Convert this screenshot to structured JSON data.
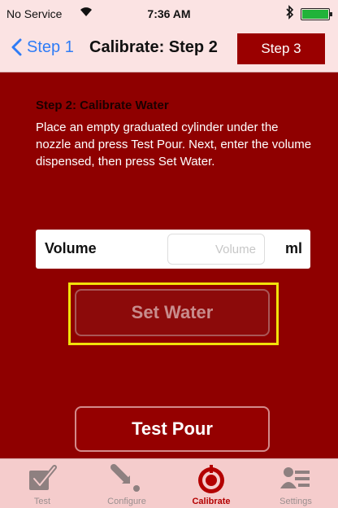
{
  "status_bar": {
    "carrier": "No Service",
    "time": "7:36 AM"
  },
  "nav": {
    "back_label": "Step 1",
    "title": "Calibrate: Step 2",
    "next_label": "Step 3"
  },
  "content": {
    "heading": "Step 2: Calibrate Water",
    "instructions": "Place an empty graduated cylinder under the nozzle and press Test Pour. Next, enter the volume dispensed, then press Set Water.",
    "volume_label": "Volume",
    "volume_placeholder": "Volume",
    "volume_value": "",
    "volume_unit": "ml",
    "set_water_label": "Set Water",
    "test_pour_label": "Test Pour"
  },
  "tabs": [
    {
      "label": "Test",
      "icon": "checkmark-icon"
    },
    {
      "label": "Configure",
      "icon": "configure-icon"
    },
    {
      "label": "Calibrate",
      "icon": "calibrate-icon",
      "active": true
    },
    {
      "label": "Settings",
      "icon": "settings-icon"
    }
  ],
  "colors": {
    "background": "#8f0000",
    "accent": "#9a0000",
    "highlight": "#f2e20a",
    "link": "#2f7cf6"
  }
}
